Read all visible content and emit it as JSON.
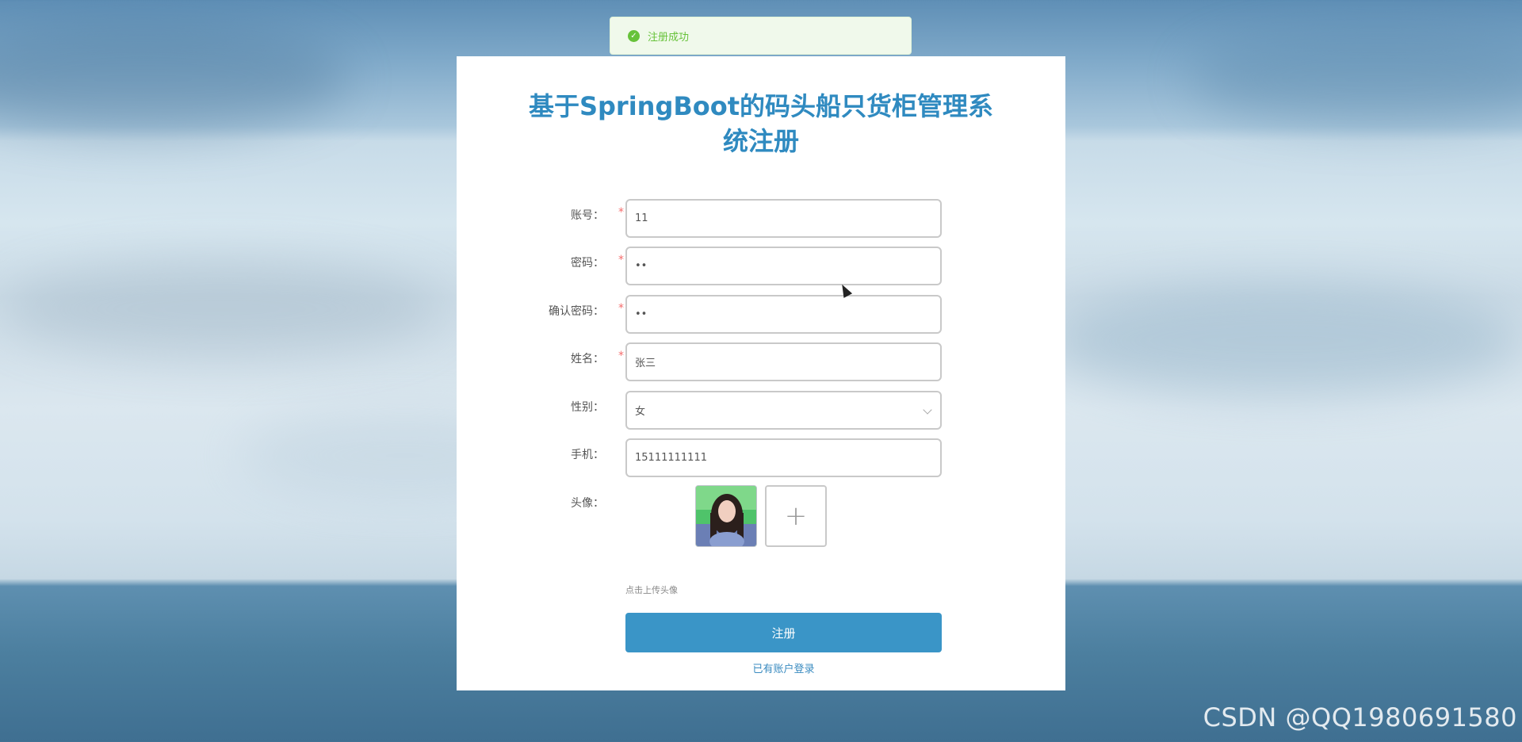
{
  "toast": {
    "icon": "check-circle-icon",
    "text": "注册成功",
    "color": "#67c23a"
  },
  "form": {
    "title": "基于SpringBoot的码头船只货柜管理系统注册",
    "fields": [
      {
        "label": "账号：",
        "required": true,
        "value": "11"
      },
      {
        "label": "密码：",
        "required": true,
        "value": "••"
      },
      {
        "label": "确认密码：",
        "required": true,
        "value": "••"
      },
      {
        "label": "姓名：",
        "required": true,
        "value": "张三"
      },
      {
        "label": "性别：",
        "required": false,
        "value": "女"
      },
      {
        "label": "手机：",
        "required": false,
        "value": "15111111111"
      }
    ],
    "required_mark": "*",
    "avatar": {
      "label": "头像：",
      "plus": "+",
      "hint": "点击上传头像"
    },
    "submit_label": "注册",
    "login_link": "已有账户登录"
  },
  "colors": {
    "title": "#2f8ac0",
    "button": "#3a95c7",
    "required": "#f56c6c"
  },
  "watermark": "CSDN @QQ1980691580"
}
